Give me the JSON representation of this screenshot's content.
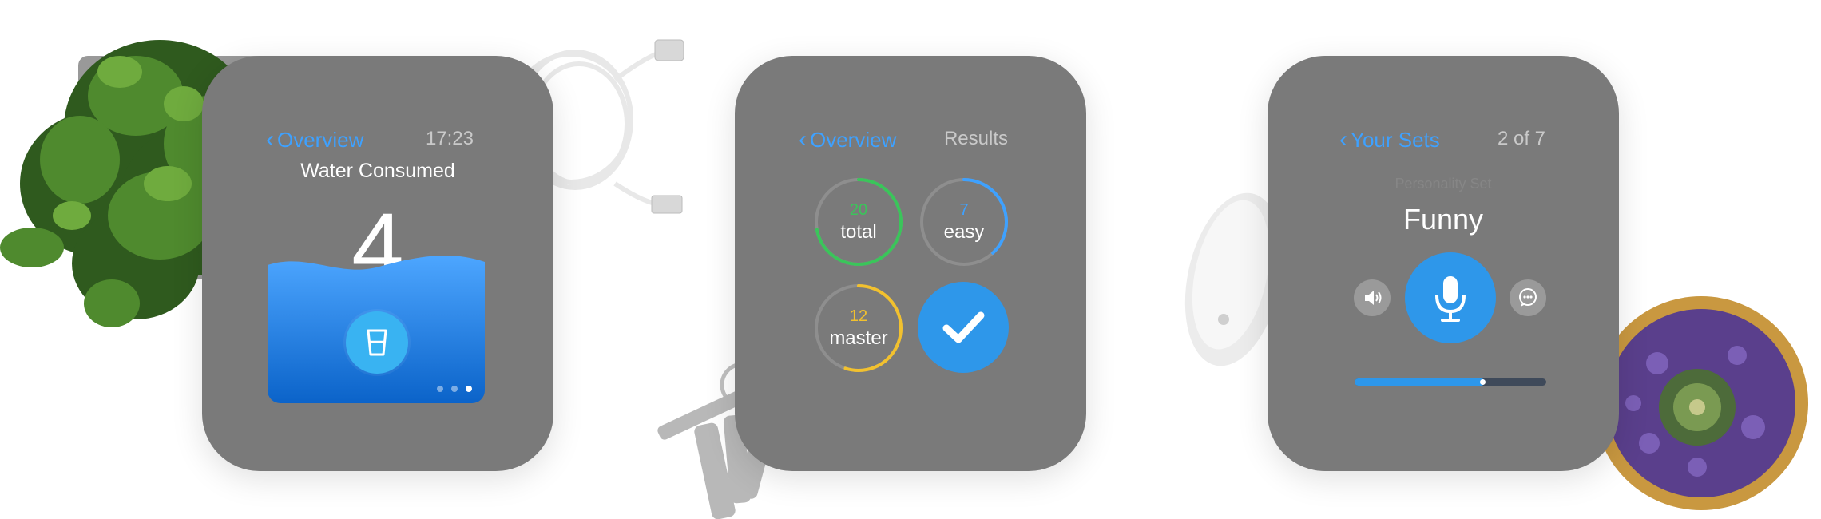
{
  "watch_water": {
    "back_label": "Overview",
    "time": "17:23",
    "title": "Water Consumed",
    "count": "4",
    "water_level": 0.72,
    "page_dots": 3,
    "active_page": 3,
    "icons": {
      "back": "chevron-left-icon",
      "action": "glass-icon"
    }
  },
  "watch_results": {
    "back_label": "Overview",
    "title": "Results",
    "stats": [
      {
        "value": "20",
        "label": "total",
        "color": "#3ac55a",
        "fraction": 0.72
      },
      {
        "value": "7",
        "label": "easy",
        "color": "#3ea1ff",
        "fraction": 0.38
      },
      {
        "value": "12",
        "label": "master",
        "color": "#f2c12e",
        "fraction": 0.55
      }
    ],
    "icons": {
      "confirm": "checkmark-icon"
    }
  },
  "watch_sets": {
    "back_label": "Your Sets",
    "counter": "2 of 7",
    "subtitle": "Personality Set",
    "title": "Funny",
    "progress": 0.68,
    "icons": {
      "left": "speaker-icon",
      "center": "microphone-icon",
      "right": "chat-bubble-icon"
    }
  },
  "colors": {
    "watch_body": "#7a7a7a",
    "accent_blue": "#2e97ea",
    "link_blue": "#3ea1ff"
  }
}
